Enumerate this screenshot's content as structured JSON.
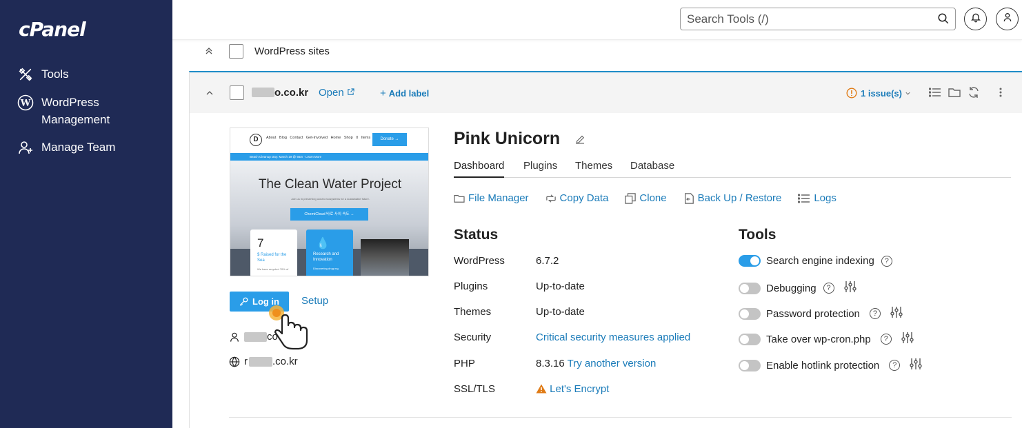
{
  "sidebar": {
    "logo": "cPanel",
    "items": [
      {
        "label": "Tools",
        "icon": "tools-icon"
      },
      {
        "label": "WordPress Management",
        "icon": "wordpress-icon"
      },
      {
        "label": "Manage Team",
        "icon": "add-user-icon"
      }
    ]
  },
  "header": {
    "search_placeholder": "Search Tools (/)"
  },
  "group": {
    "label": "WordPress sites"
  },
  "site": {
    "domain_suffix": "o.co.kr",
    "open_label": "Open",
    "add_label": "Add label",
    "issues": "1 issue(s)",
    "title": "Pink Unicorn",
    "login_label": "Log in",
    "setup_label": "Setup",
    "user_suffix": "co",
    "url_prefix": "r",
    "url_suffix": ".co.kr"
  },
  "preview": {
    "menu": "About Blog Contact Get-Involved Home Shop 0 Items",
    "donate": "Donate →",
    "strip": "Beach Cleanup Day: March 19 @ 9am · Learn More",
    "title": "The Clean Water Project",
    "subtitle": "Join us in preserving ocean ecosystems for a sustainable future.",
    "button": "ChemiCloud 바로 사이 속도 →",
    "card1_number": "7",
    "card1_text": "$ Raised for the Sea",
    "card1_note": "We have recycled 70% of",
    "card2_text": "Research and Innovation",
    "card2_note": "Discovering drug mg"
  },
  "tabs": [
    "Dashboard",
    "Plugins",
    "Themes",
    "Database"
  ],
  "actions": [
    "File Manager",
    "Copy Data",
    "Clone",
    "Back Up / Restore",
    "Logs"
  ],
  "status": {
    "title": "Status",
    "rows": [
      {
        "key": "WordPress",
        "value": "6.7.2"
      },
      {
        "key": "Plugins",
        "value": "Up-to-date"
      },
      {
        "key": "Themes",
        "value": "Up-to-date"
      },
      {
        "key": "Security",
        "value": "Critical security measures applied"
      },
      {
        "key": "PHP",
        "value": "8.3.16",
        "link": "Try another version"
      },
      {
        "key": "SSL/TLS",
        "value": "Let's Encrypt"
      }
    ]
  },
  "tools": {
    "title": "Tools",
    "items": [
      {
        "label": "Search engine indexing",
        "on": true,
        "settings": false
      },
      {
        "label": "Debugging",
        "on": false,
        "settings": true
      },
      {
        "label": "Password protection",
        "on": false,
        "settings": true
      },
      {
        "label": "Take over wp-cron.php",
        "on": false,
        "settings": true
      },
      {
        "label": "Enable hotlink protection",
        "on": false,
        "settings": true
      }
    ]
  },
  "colors": {
    "sidebar": "#1f2a55",
    "accent": "#2a9de8",
    "link": "#1a7bb9",
    "warning": "#e07b16"
  }
}
